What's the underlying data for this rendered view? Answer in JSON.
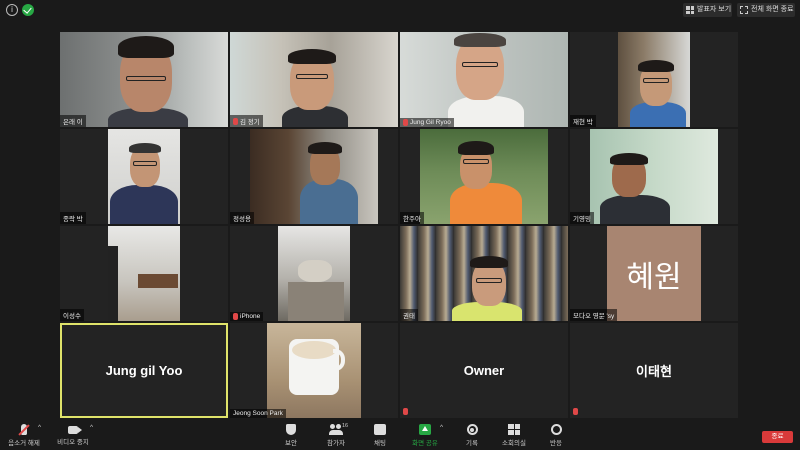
{
  "top_bar": {
    "speaker_view_label": "발표자 보기",
    "fullscreen_label": "전체 화면 종료"
  },
  "participants": [
    {
      "name": "은래 이",
      "muted": false
    },
    {
      "name": "김 정기",
      "muted": true
    },
    {
      "name": "Jung Gil Ryoo",
      "muted": true
    },
    {
      "name": "재현 박",
      "muted": false
    },
    {
      "name": "종락 박",
      "muted": false
    },
    {
      "name": "정성용",
      "muted": false
    },
    {
      "name": "한주아",
      "muted": false
    },
    {
      "name": "기영밍",
      "muted": false
    },
    {
      "name": "이성수",
      "muted": false
    },
    {
      "name": "iPhone",
      "muted": true
    },
    {
      "name": "권태",
      "muted": false
    },
    {
      "name": "모다오 영문 'sy",
      "muted": false,
      "initial": "혜원"
    },
    {
      "name": "Jung gil Yoo",
      "muted": false
    },
    {
      "name": "Jeong Soon Park",
      "muted": false
    },
    {
      "name": "Owner",
      "muted": true
    },
    {
      "name": "이태현",
      "muted": true
    }
  ],
  "toolbar": {
    "unmute_label": "음소거 해제",
    "stop_video_label": "비디오 중지",
    "security_label": "보안",
    "participants_label": "참가자",
    "participants_count": "16",
    "chat_label": "채팅",
    "share_screen_label": "화면 공유",
    "record_label": "기록",
    "breakout_label": "소회의실",
    "reactions_label": "반응",
    "end_label": "종료"
  },
  "colors": {
    "active_speaker_border": "#dfe36a",
    "end_button": "#d93a3a",
    "share_screen_green": "#27a844",
    "mute_red": "#e04848"
  }
}
